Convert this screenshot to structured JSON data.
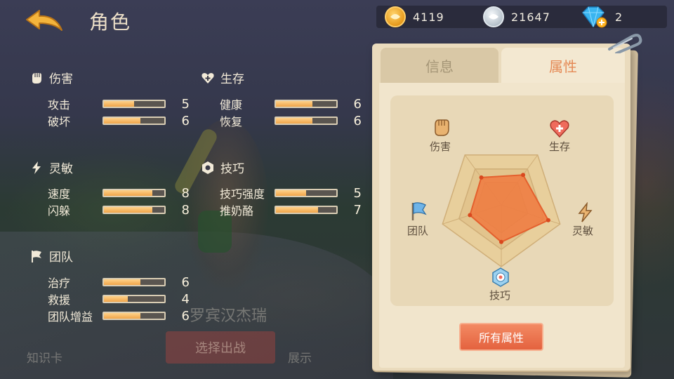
{
  "header": {
    "title": "角色",
    "back_icon": "back-arrow-icon"
  },
  "currency": [
    {
      "icon": "gold-coin-icon",
      "amount": "4119"
    },
    {
      "icon": "silver-coin-icon",
      "amount": "21647"
    },
    {
      "icon": "diamond-icon",
      "amount": "2"
    }
  ],
  "sections": {
    "damage": {
      "title": "伤害",
      "rows": [
        {
          "label": "攻击",
          "value": 5
        },
        {
          "label": "破坏",
          "value": 6
        }
      ]
    },
    "survival": {
      "title": "生存",
      "rows": [
        {
          "label": "健康",
          "value": 6
        },
        {
          "label": "恢复",
          "value": 6
        }
      ]
    },
    "agility": {
      "title": "灵敏",
      "rows": [
        {
          "label": "速度",
          "value": 8
        },
        {
          "label": "闪躲",
          "value": 8
        }
      ]
    },
    "skill": {
      "title": "技巧",
      "rows": [
        {
          "label": "技巧强度",
          "value": 5
        },
        {
          "label": "推奶酪",
          "value": 7
        }
      ]
    },
    "team": {
      "title": "团队",
      "rows": [
        {
          "label": "治疗",
          "value": 6
        },
        {
          "label": "救援",
          "value": 4
        },
        {
          "label": "团队增益",
          "value": 6
        }
      ]
    }
  },
  "stat_max": 10,
  "background_ui": {
    "knowledge_card": "知识卡",
    "select_battle": "选择出战",
    "display": "展示",
    "character_name": "罗宾汉杰瑞"
  },
  "panel": {
    "tabs": {
      "info": "信息",
      "attributes": "属性"
    },
    "radar": {
      "damage": "伤害",
      "survival": "生存",
      "agility": "灵敏",
      "skill": "技巧",
      "team": "团队"
    },
    "all_attributes_button": "所有属性"
  },
  "colors": {
    "accent": "#e4623f",
    "bar_fill": "#f0a54a",
    "radar_fill": "#f07a3f"
  }
}
